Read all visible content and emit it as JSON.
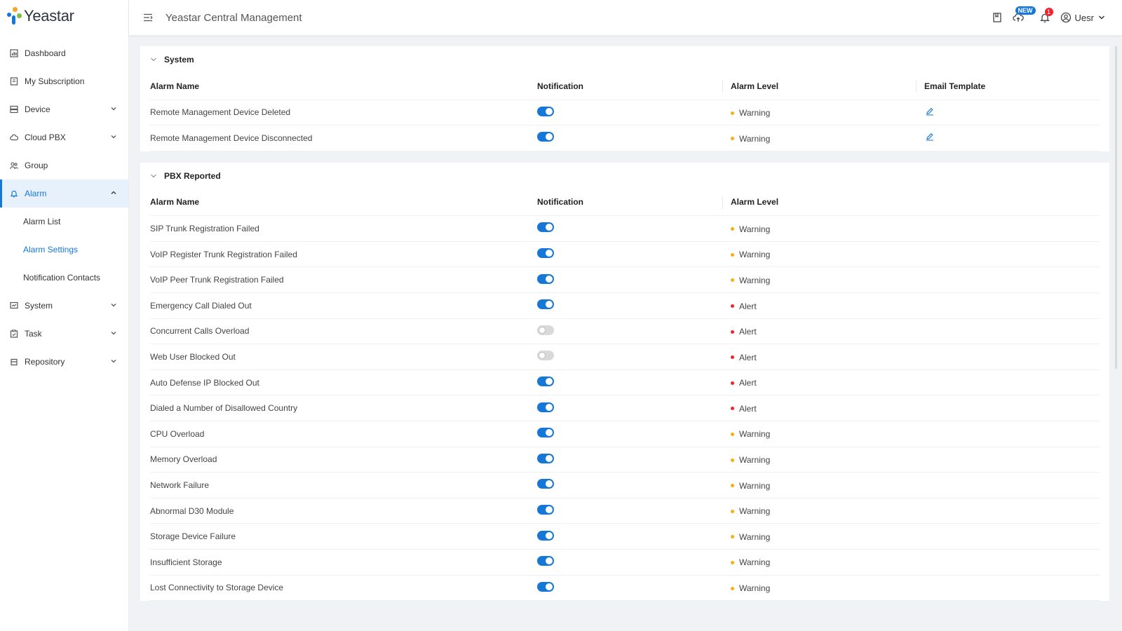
{
  "app": {
    "logo_text": "Yeastar",
    "title": "Yeastar Central Management"
  },
  "header": {
    "new_badge": "NEW",
    "notification_count": "1",
    "user_name": "Uesr"
  },
  "sidebar": {
    "items": [
      {
        "label": "Dashboard",
        "icon": "dashboard-icon"
      },
      {
        "label": "My Subscription",
        "icon": "subscription-icon"
      },
      {
        "label": "Device",
        "icon": "device-icon"
      },
      {
        "label": "Cloud PBX",
        "icon": "cloud-pbx-icon"
      },
      {
        "label": "Group",
        "icon": "group-icon"
      },
      {
        "label": "Alarm",
        "icon": "bell-icon"
      },
      {
        "label": "System",
        "icon": "system-icon"
      },
      {
        "label": "Task",
        "icon": "task-icon"
      },
      {
        "label": "Repository",
        "icon": "repository-icon"
      }
    ],
    "alarm_sub": [
      {
        "label": "Alarm List"
      },
      {
        "label": "Alarm Settings"
      },
      {
        "label": "Notification Contacts"
      }
    ]
  },
  "colors": {
    "accent": "#1677d6",
    "warning": "#faad14",
    "alert": "#f5222d"
  },
  "system_section": {
    "title": "System",
    "headers": {
      "name": "Alarm Name",
      "notification": "Notification",
      "level": "Alarm Level",
      "template": "Email Template"
    },
    "rows": [
      {
        "name": "Remote Management Device Deleted",
        "enabled": true,
        "level": "Warning"
      },
      {
        "name": "Remote Management Device Disconnected",
        "enabled": true,
        "level": "Warning"
      }
    ]
  },
  "pbx_section": {
    "title": "PBX Reported",
    "headers": {
      "name": "Alarm Name",
      "notification": "Notification",
      "level": "Alarm Level"
    },
    "rows": [
      {
        "name": "SIP Trunk Registration Failed",
        "enabled": true,
        "level": "Warning"
      },
      {
        "name": "VoIP Register Trunk Registration Failed",
        "enabled": true,
        "level": "Warning"
      },
      {
        "name": "VoIP Peer Trunk Registration Failed",
        "enabled": true,
        "level": "Warning"
      },
      {
        "name": "Emergency Call Dialed Out",
        "enabled": true,
        "level": "Alert"
      },
      {
        "name": "Concurrent Calls Overload",
        "enabled": false,
        "level": "Alert"
      },
      {
        "name": "Web User Blocked Out",
        "enabled": false,
        "level": "Alert"
      },
      {
        "name": "Auto Defense IP Blocked Out",
        "enabled": true,
        "level": "Alert"
      },
      {
        "name": "Dialed a Number of Disallowed Country",
        "enabled": true,
        "level": "Alert"
      },
      {
        "name": "CPU Overload",
        "enabled": true,
        "level": "Warning"
      },
      {
        "name": "Memory Overload",
        "enabled": true,
        "level": "Warning"
      },
      {
        "name": "Network Failure",
        "enabled": true,
        "level": "Warning"
      },
      {
        "name": "Abnormal D30 Module",
        "enabled": true,
        "level": "Warning"
      },
      {
        "name": "Storage Device Failure",
        "enabled": true,
        "level": "Warning"
      },
      {
        "name": "Insufficient Storage",
        "enabled": true,
        "level": "Warning"
      },
      {
        "name": "Lost Connectivity to Storage Device",
        "enabled": true,
        "level": "Warning"
      }
    ]
  }
}
